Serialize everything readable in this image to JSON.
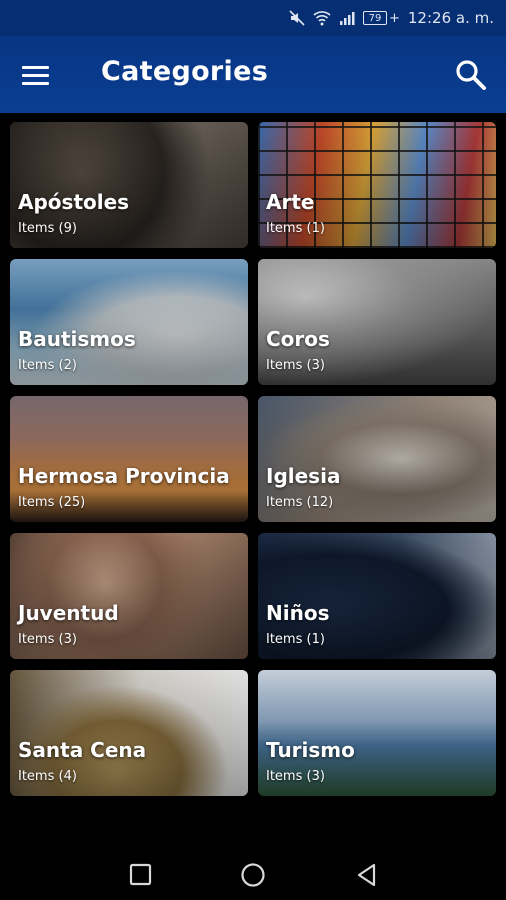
{
  "status_bar": {
    "battery": "79",
    "time": "12:26 a. m."
  },
  "app_bar": {
    "title": "Categories"
  },
  "categories": [
    {
      "name": "Apóstoles",
      "count": "Items (9)"
    },
    {
      "name": "Arte",
      "count": "Items (1)"
    },
    {
      "name": "Bautismos",
      "count": "Items (2)"
    },
    {
      "name": "Coros",
      "count": "Items (3)"
    },
    {
      "name": "Hermosa Provincia",
      "count": "Items (25)"
    },
    {
      "name": "Iglesia",
      "count": "Items (12)"
    },
    {
      "name": "Juventud",
      "count": "Items (3)"
    },
    {
      "name": "Niños",
      "count": "Items (1)"
    },
    {
      "name": "Santa Cena",
      "count": "Items (4)"
    },
    {
      "name": "Turismo",
      "count": "Items (3)"
    }
  ],
  "colors": {
    "status_bar": "#062e73",
    "app_bar": "#0a3e92",
    "background": "#000000"
  }
}
